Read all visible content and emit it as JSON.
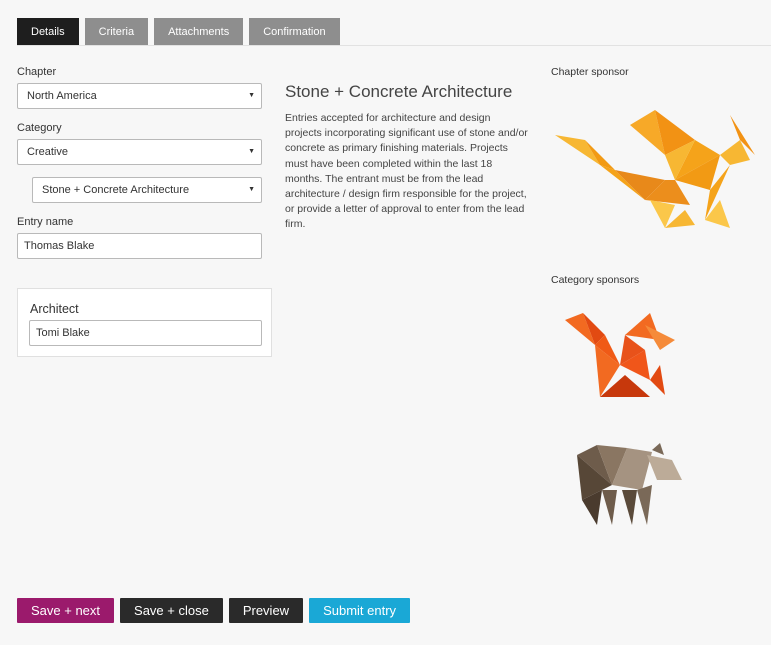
{
  "tabs": [
    {
      "label": "Details",
      "active": true
    },
    {
      "label": "Criteria",
      "active": false
    },
    {
      "label": "Attachments",
      "active": false
    },
    {
      "label": "Confirmation",
      "active": false
    }
  ],
  "form": {
    "chapter_label": "Chapter",
    "chapter_value": "North America",
    "category_label": "Category",
    "category_value": "Creative",
    "subcategory_value": "Stone + Concrete Architecture",
    "entry_name_label": "Entry name",
    "entry_name_value": "Thomas Blake",
    "architect_label": "Architect",
    "architect_value": "Tomi Blake"
  },
  "category_info": {
    "title": "Stone + Concrete Architecture",
    "description": "Entries accepted for architecture and design projects incorporating significant use of stone and/or concrete as primary finishing materials. Projects must have been completed within the last 18 months. The entrant must be from the lead architecture / design firm responsible for the project, or provide a letter of approval to enter from the lead firm."
  },
  "sponsors": {
    "chapter_label": "Chapter sponsor",
    "category_label": "Category sponsors",
    "chapter_logo": "origami-dragon-icon",
    "category_logos": [
      "origami-squirrel-icon",
      "origami-bear-icon"
    ]
  },
  "actions": {
    "save_next": "Save + next",
    "save_close": "Save + close",
    "preview": "Preview",
    "submit": "Submit entry"
  },
  "colors": {
    "tab_active": "#1e1e1e",
    "tab_inactive": "#8e8e8e",
    "save_next_bg": "#9b1a6c",
    "dark_button_bg": "#2a2a2a",
    "submit_bg": "#1aa8d6",
    "dragon": "#f5a31a",
    "squirrel": "#f05a16",
    "bear": "#7a6958"
  }
}
